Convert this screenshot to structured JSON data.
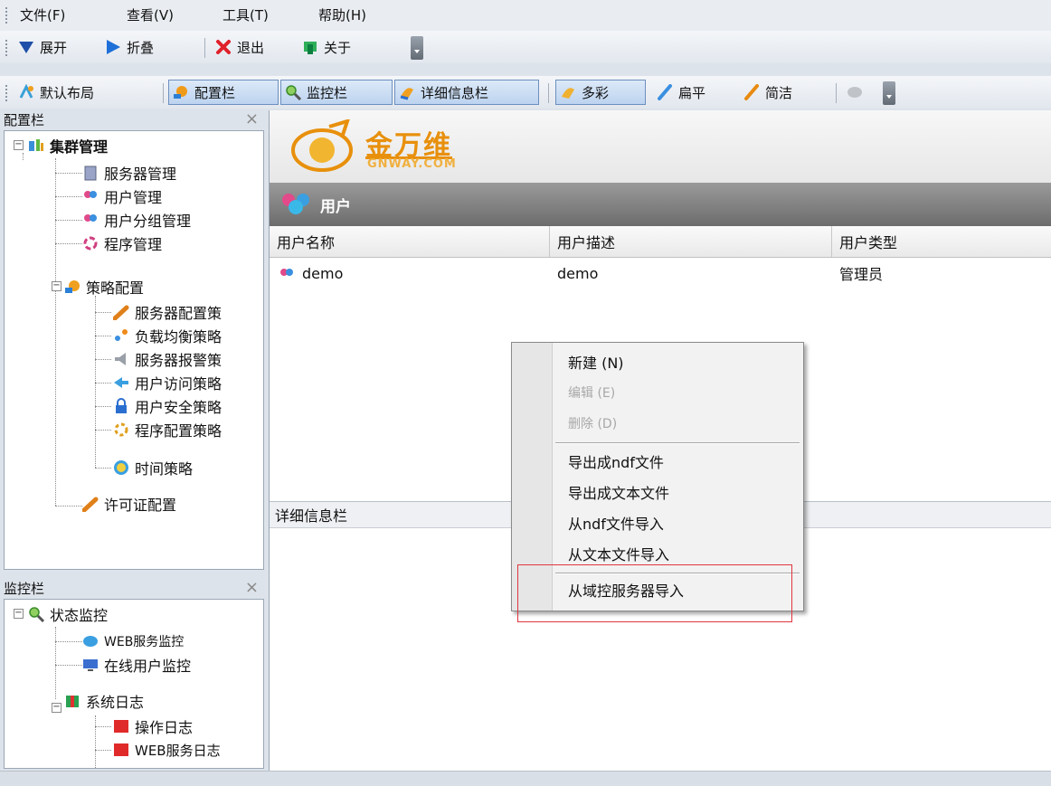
{
  "menubar": {
    "items": [
      "文件(F)",
      "查看(V)",
      "工具(T)",
      "帮助(H)"
    ]
  },
  "toolbar1": {
    "expand": "展开",
    "collapse": "折叠",
    "exit": "退出",
    "about": "关于"
  },
  "toolbar2": {
    "default_layout": "默认布局",
    "config_bar": "配置栏",
    "monitor_bar": "监控栏",
    "detail_bar": "详细信息栏",
    "theme_colorful": "多彩",
    "theme_flat": "扁平",
    "theme_simple": "简洁"
  },
  "config_panel": {
    "title": "配置栏",
    "tree": [
      "集群管理",
      "服务器管理",
      "用户管理",
      "用户分组管理",
      "程序管理",
      "策略配置",
      "服务器配置策",
      "负载均衡策略",
      "服务器报警策",
      "用户访问策略",
      "用户安全策略",
      "程序配置策略",
      "时间策略",
      "许可证配置"
    ]
  },
  "monitor_panel": {
    "title": "监控栏",
    "tree": [
      "状态监控",
      "WEB服务监控",
      "在线用户监控",
      "系统日志",
      "操作日志",
      "WEB服务日志"
    ]
  },
  "logo": {
    "brand": "金万维",
    "domain": "GNWAY.COM"
  },
  "main": {
    "section_title": "用户",
    "columns": [
      "用户名称",
      "用户描述",
      "用户类型"
    ],
    "rows": [
      {
        "name": "demo",
        "description": "demo",
        "type": "管理员"
      }
    ],
    "detail_title": "详细信息栏"
  },
  "context_menu": {
    "items": [
      {
        "label": "新建 (N)",
        "enabled": true
      },
      {
        "label": "编辑 (E)",
        "enabled": false
      },
      {
        "label": "删除 (D)",
        "enabled": false
      },
      {
        "label": "导出成ndf文件",
        "enabled": true
      },
      {
        "label": "导出成文本文件",
        "enabled": true
      },
      {
        "label": "从ndf文件导入",
        "enabled": true
      },
      {
        "label": "从文本文件导入",
        "enabled": true
      },
      {
        "label": "从域控服务器导入",
        "enabled": true
      }
    ]
  },
  "colors": {
    "annotation": "#e0353d",
    "section_header": "#7a7a7a",
    "brand_orange": "#e8900c"
  }
}
